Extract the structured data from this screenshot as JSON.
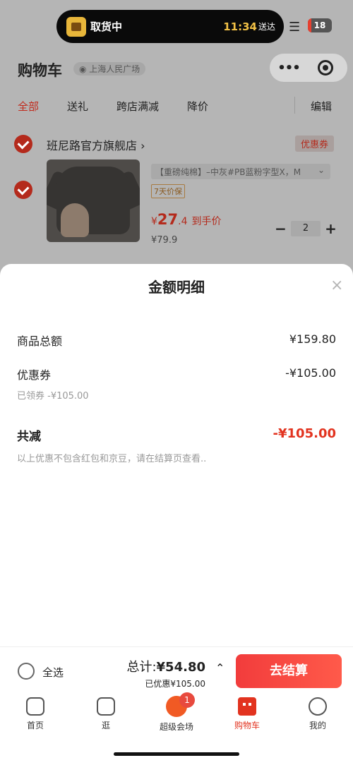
{
  "status_bar": {
    "pickup_label": "取货中",
    "eta_time": "11:34",
    "eta_suffix": "送达",
    "battery": "18"
  },
  "header": {
    "title": "购物车",
    "location": "上海人民广场",
    "menu_dots": "•••"
  },
  "filter_tabs": [
    {
      "label": "全部",
      "active": true
    },
    {
      "label": "送礼",
      "active": false
    },
    {
      "label": "跨店满减",
      "active": false
    },
    {
      "label": "降价",
      "active": false
    }
  ],
  "edit_label": "编辑",
  "store": {
    "name": "班尼路官方旗舰店 ›",
    "coupon_tag": "优惠券"
  },
  "product": {
    "spec": "【重磅纯棉】–中灰#PB蓝粉字型X，M",
    "warranty_tag": "7天价保",
    "price_yen": "¥",
    "price_int": "27",
    "price_dec": ".4",
    "price_suffix": "到手价",
    "original_price": "¥79.9",
    "quantity": "2"
  },
  "sheet": {
    "title": "金额明细",
    "close": "×",
    "goods_total_label": "商品总额",
    "goods_total_value": "¥159.80",
    "coupon_label": "优惠券",
    "coupon_value": "-¥105.00",
    "coupon_sub": "已领券 -¥105.00",
    "reduce_label": "共减",
    "reduce_value": "-¥105.00",
    "note": "以上优惠不包含红包和京豆，请在结算页查看.."
  },
  "checkout": {
    "select_all": "全选",
    "total_prefix": "总计:",
    "total_amount": "¥54.80",
    "saved": "已优惠¥105.00",
    "button": "去结算"
  },
  "tabbar": {
    "items": [
      {
        "label": "首页"
      },
      {
        "label": "逛"
      },
      {
        "label": "超级会场"
      },
      {
        "label": "购物车"
      },
      {
        "label": "我的"
      }
    ],
    "promo_badge": "1"
  },
  "colors": {
    "accent": "#e2331f",
    "checkout_button": "#f23c3c"
  }
}
